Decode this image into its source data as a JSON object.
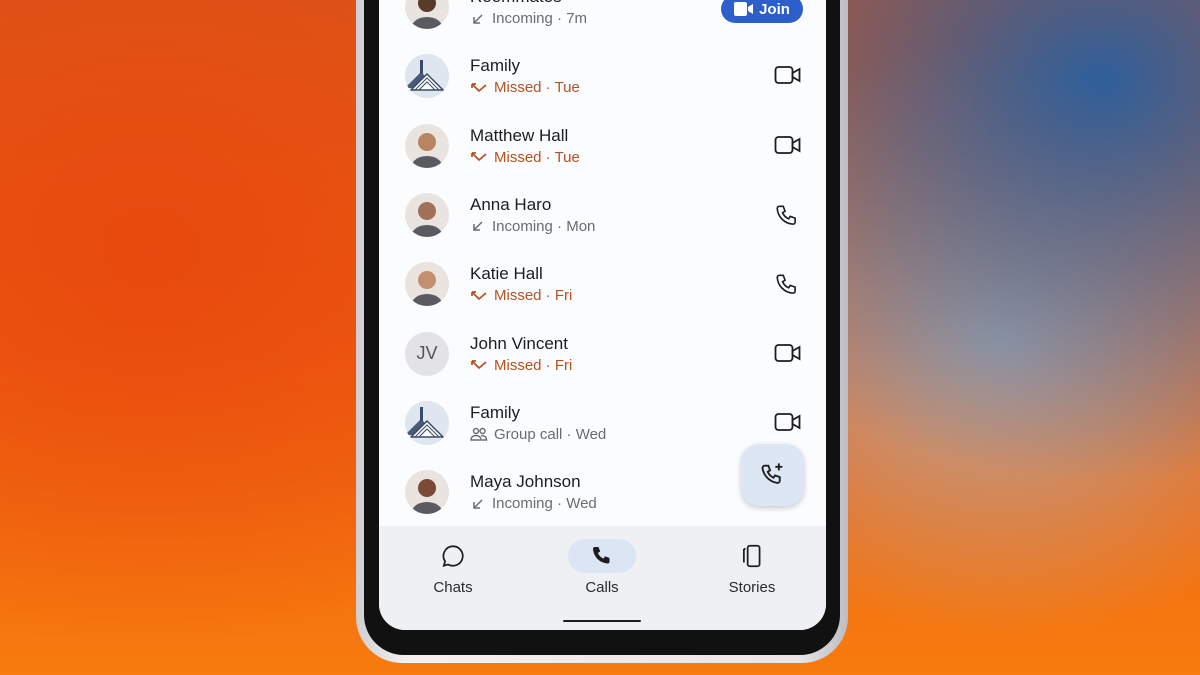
{
  "calls": [
    {
      "name": "Roommates",
      "avatar": "photo",
      "status": "Incoming · 7m",
      "type": "incoming",
      "action": "join",
      "action_label": "Join"
    },
    {
      "name": "Family",
      "avatar": "house",
      "status": "Missed · Tue",
      "type": "missed",
      "action": "video-icon"
    },
    {
      "name": "Matthew Hall",
      "avatar": "photo",
      "status": "Missed · Tue",
      "type": "missed",
      "action": "video-icon"
    },
    {
      "name": "Anna Haro",
      "avatar": "photo",
      "status": "Incoming · Mon",
      "type": "incoming",
      "action": "phone-icon"
    },
    {
      "name": "Katie Hall",
      "avatar": "photo",
      "status": "Missed · Fri",
      "type": "missed",
      "action": "phone-icon"
    },
    {
      "name": "John Vincent",
      "avatar": "initials",
      "initials": "JV",
      "status": "Missed · Fri",
      "type": "missed",
      "action": "video-icon"
    },
    {
      "name": "Family",
      "avatar": "house",
      "status": "Group call · Wed",
      "type": "group",
      "action": "video-icon"
    },
    {
      "name": "Maya Johnson",
      "avatar": "photo",
      "status": "Incoming · Wed",
      "type": "incoming",
      "action": "none"
    }
  ],
  "fab": {
    "icon": "new-call-icon"
  },
  "nav": {
    "tabs": [
      {
        "label": "Chats",
        "icon": "chat-bubble-icon"
      },
      {
        "label": "Calls",
        "icon": "phone-icon",
        "active": true
      },
      {
        "label": "Stories",
        "icon": "stories-icon"
      }
    ]
  },
  "colors": {
    "accent": "#2c5fc9",
    "missed": "#b8501f",
    "nav_bg": "#eef0f4",
    "active_pill": "#dce5f3"
  }
}
